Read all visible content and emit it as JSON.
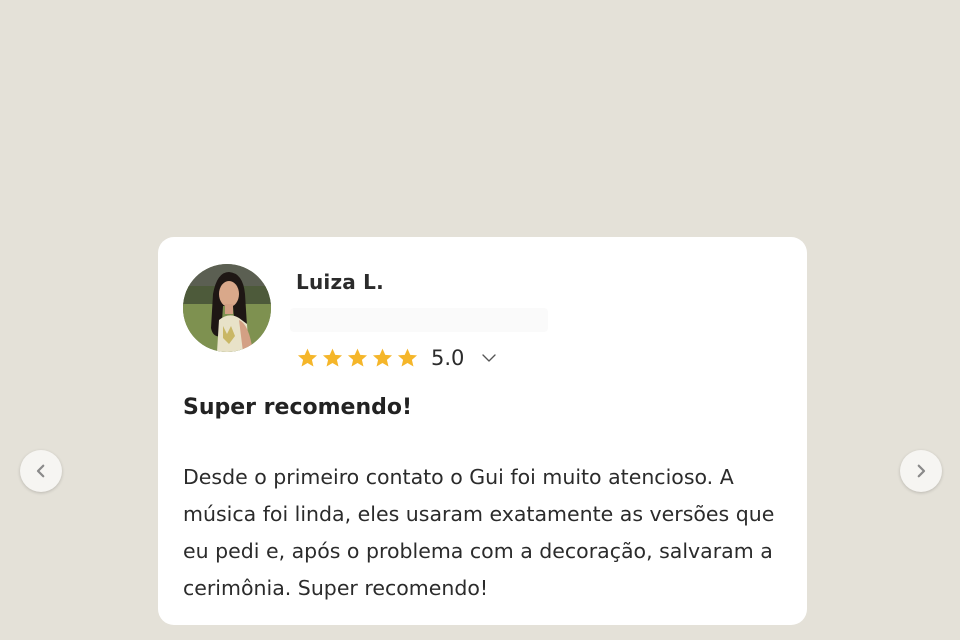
{
  "review": {
    "author": "Luiza L.",
    "rating_value": "5.0",
    "rating_stars": 5,
    "title": "Super recomendo!",
    "body": "Desde o primeiro contato o Gui foi muito atencioso. A música foi linda, eles usaram exatamente as versões que eu pedi e, após o problema com a decoração, salvaram a cerimônia. Super recomendo!"
  },
  "colors": {
    "background": "#e4e1d8",
    "card": "#ffffff",
    "star": "#f5b62a",
    "text": "#2b2b2b"
  },
  "icons": {
    "prev": "chevron-left-icon",
    "next": "chevron-right-icon",
    "expand": "chevron-down-icon",
    "star": "star-icon"
  }
}
